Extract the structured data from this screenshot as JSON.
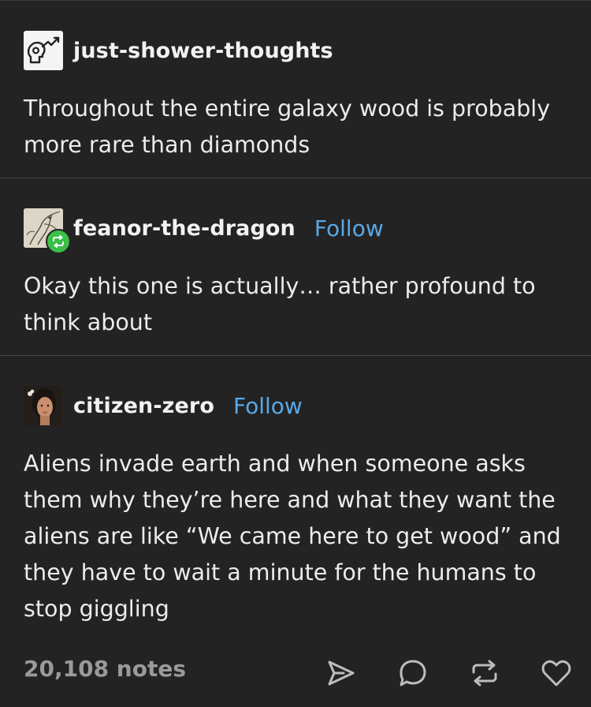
{
  "thread": [
    {
      "username": "just-shower-thoughts",
      "follow_label": "",
      "avatar_icon": "lightbulb-head-chart-icon",
      "text": "Throughout the entire galaxy wood is probably more rare than diamonds"
    },
    {
      "username": "feanor-the-dragon",
      "follow_label": "Follow",
      "avatar_icon": "dragon-sketch-avatar",
      "badge_icon": "reblog-badge-icon",
      "text": "Okay this one is actually… rather profound to think about"
    },
    {
      "username": "citizen-zero",
      "follow_label": "Follow",
      "avatar_icon": "person-photo-avatar",
      "text": "Aliens invade earth and when someone asks them why they’re here and what they want the aliens are like “We came here to get wood” and they have to wait a minute for the humans to stop giggling"
    }
  ],
  "footer": {
    "notes": "20,108 notes",
    "actions": [
      "share-icon",
      "reply-icon",
      "reblog-icon",
      "like-icon"
    ]
  },
  "colors": {
    "background": "#232323",
    "link": "#5aa9e6",
    "reblog_green": "#3bbf49",
    "muted": "#9a9a9a"
  }
}
